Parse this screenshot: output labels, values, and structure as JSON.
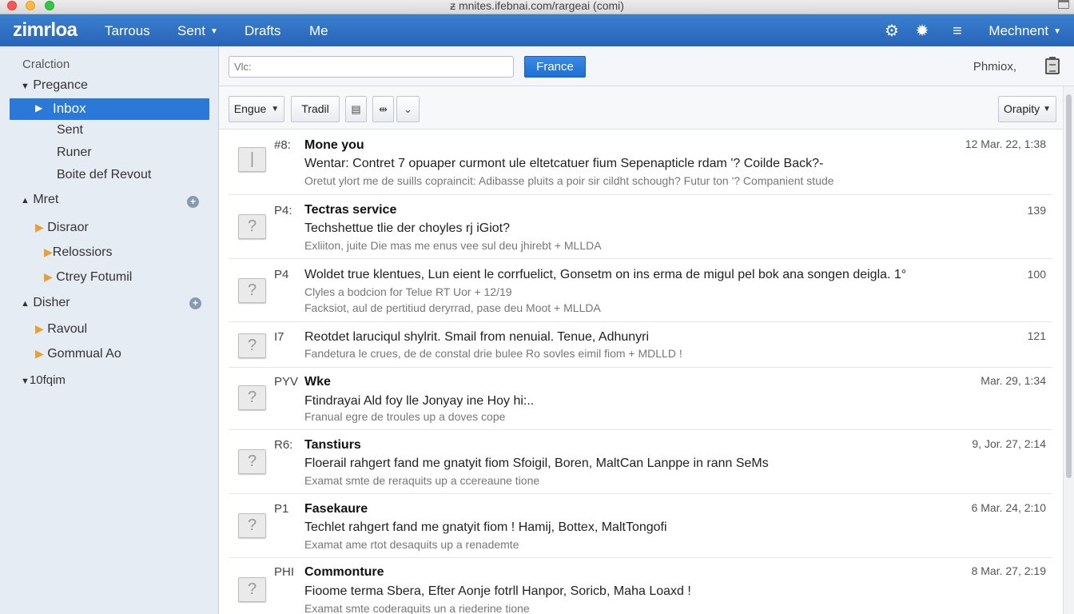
{
  "window": {
    "title": "ƶ mnites.ifebnai.com/rargeai (comi)"
  },
  "appbar": {
    "logo": "zimrloa",
    "nav": [
      {
        "label": "Tarrous",
        "has_caret": false
      },
      {
        "label": "Sent",
        "has_caret": true
      },
      {
        "label": "Drafts",
        "has_caret": false
      },
      {
        "label": "Me",
        "has_caret": false
      }
    ],
    "icons": [
      "gear-icon",
      "settings-icon",
      "menu-icon"
    ],
    "user_menu": "Mechnent"
  },
  "sidebar": {
    "heading": "Cralction",
    "sections": [
      {
        "label": "Pregance",
        "items": [
          "Inbox",
          "Sent",
          "Runer",
          "Boite def Revout"
        ]
      },
      {
        "label": "Mret",
        "items": [
          "Disraor",
          "Relossiors",
          "Ctrey Fotumil"
        ]
      },
      {
        "label": "Disher",
        "items": [
          "Ravoul",
          "Gommual Ao"
        ]
      },
      {
        "label": "10fqim",
        "items": []
      }
    ],
    "selected": "Inbox"
  },
  "search": {
    "placeholder": "Vlc:",
    "button": "France",
    "right_text": "Phmiox,"
  },
  "toolbar": {
    "engue": "Engue",
    "tradil": "Tradil",
    "sort": "Orapity"
  },
  "messages": [
    {
      "tag": "#8:",
      "sender": "Mone you",
      "line2": "Wentar: Contret 7 opuaper curmont ule eltetcatuer fium Sepenapticle rdam '? Coilde Back?-",
      "line3": "Oretut ylort me de suills copraincit: Adibasse pluits a poir sir cildht schough? Futur ton '? Companient stude",
      "date": "12 Mar. 22, 1:38",
      "unread": true
    },
    {
      "tag": "P4:",
      "sender": "Tectras service",
      "line2": "Techshettue tlie der choyles rj iGiot?",
      "line3": "Exliiton, juite Die mas me enus vee sul deu jhirebt + MLLDA",
      "date": "139",
      "unread": true
    },
    {
      "tag": "P4",
      "sender": "",
      "line2": "Woldet true klentues, Lun eient le corrfuelict, Gonsetm on ins erma de migul pel bok ana songen deigla. 1°",
      "line3": "Clyles a bodcion for Telue RT Uor + 12/19",
      "line4": "Facksiot, aul de pertitiud deryrrad, pase deu Moot + MLLDA",
      "date": "100",
      "unread": false
    },
    {
      "tag": "I7",
      "sender": "",
      "line2": "Reotdet laruciqul shylrit. Smail from nenuial. Tenue, Adhunyri",
      "line3": "Fandetura le crues, de de constal drie bulee Ro sovles eimil fiom + MDLLD !",
      "date": "121",
      "unread": false
    },
    {
      "tag": "PYV",
      "sender": "Wke",
      "line2": "Ftindrayai Ald foy lle Jonyay ine Hoy hi:..",
      "line3": "Franual egre de troules up a doves cope",
      "date": "Mar. 29, 1:34",
      "unread": true
    },
    {
      "tag": "R6:",
      "sender": "Tanstiurs",
      "line2": "Floerail rahgert fand me gnatyit fiom Sfoigil, Boren, MaltCan Lanppe in rann SeMs",
      "line3": "Examat smte de reraquits up a ccereaune tione",
      "date": "9, Jor. 27, 2:14",
      "unread": true
    },
    {
      "tag": "P1",
      "sender": "Fasekaure",
      "line2": "Techlet rahgert fand me gnatyit fiom ! Hamij, Bottex, MaltTongofi",
      "line3": "Examat ame rtot desaquits up a renademte",
      "date": "6 Mar. 24, 2:10",
      "unread": true
    },
    {
      "tag": "PHI",
      "sender": "Commonture",
      "line2": "Fioome terma Sbera, Efter Aonje fotrll Hanpor, Soricb, Maha Loaxd !",
      "line3": "Examat smte coderaquits un a riederine tione",
      "date": "8 Mar. 27, 2:19",
      "unread": true
    }
  ]
}
